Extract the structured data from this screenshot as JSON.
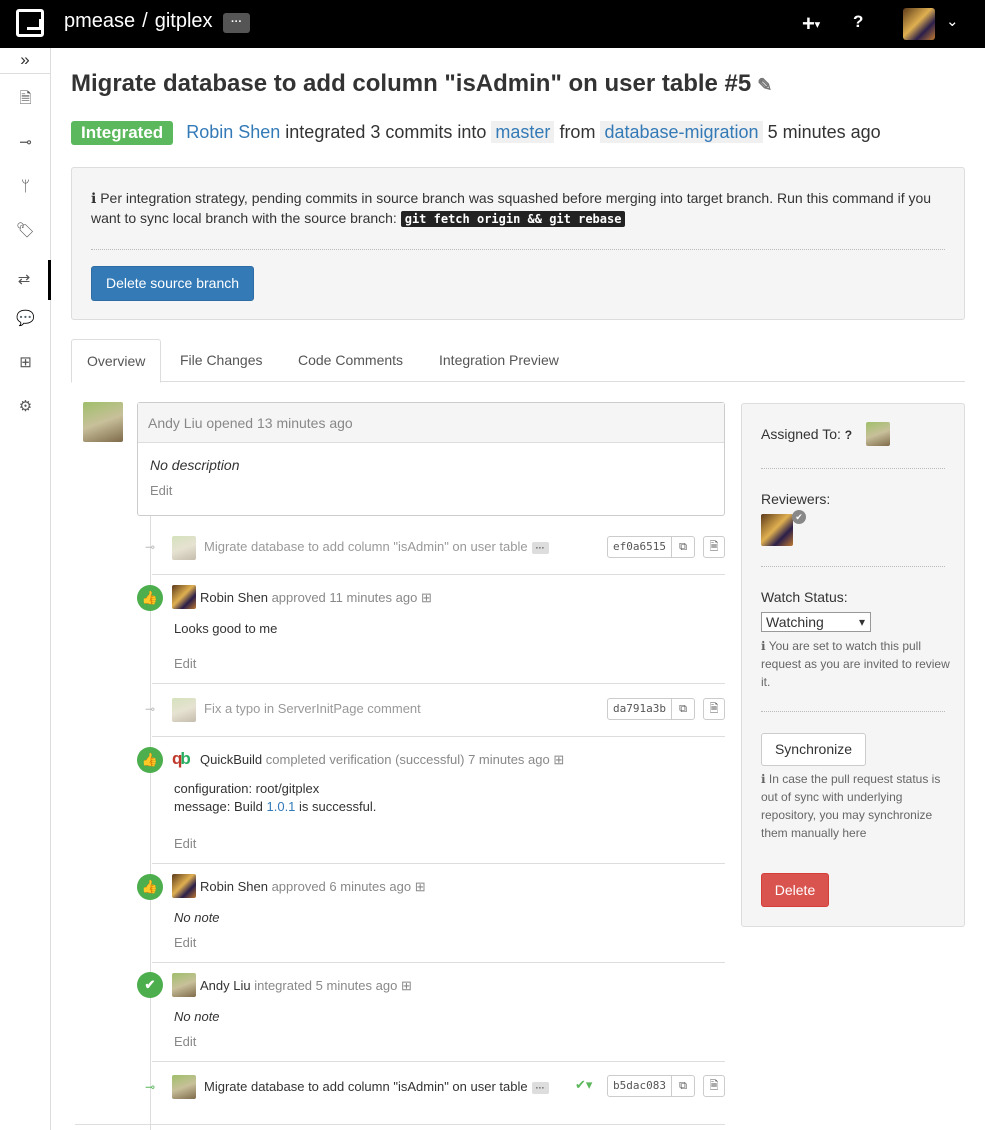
{
  "topbar": {
    "project_owner": "pmease",
    "separator": "/",
    "project_name": "gitplex",
    "more": "···",
    "plus": "+",
    "plus_caret": "▾",
    "help": "?",
    "caret": "⌄"
  },
  "sidebar": {
    "collapse": "»",
    "items": [
      {
        "name": "files",
        "glyph": "🗎"
      },
      {
        "name": "commits",
        "glyph": "⊸"
      },
      {
        "name": "branches",
        "glyph": "ᛘ"
      },
      {
        "name": "tags",
        "glyph": "🏷"
      },
      {
        "name": "pull-requests",
        "glyph": "⇄"
      },
      {
        "name": "comments",
        "glyph": "💬"
      },
      {
        "name": "compare",
        "glyph": "⊞"
      },
      {
        "name": "settings",
        "glyph": "⚙"
      }
    ]
  },
  "pr": {
    "title": "Migrate database to add column \"isAdmin\" on user table #5",
    "pencil": "✎",
    "status": "Integrated",
    "actor": "Robin Shen",
    "action": "integrated 3 commits into",
    "target_branch": "master",
    "from": "from",
    "source_branch": "database-migration",
    "time": "5 minutes ago"
  },
  "info": {
    "icon": "ℹ",
    "text": "Per integration strategy, pending commits in source branch was squashed before merging into target branch. Run this command if you want to sync local branch with the source branch:",
    "command": "git fetch origin && git rebase",
    "button": "Delete source branch"
  },
  "tabs": [
    "Overview",
    "File Changes",
    "Code Comments",
    "Integration Preview"
  ],
  "opener": {
    "head": "Andy Liu opened 13 minutes ago",
    "body": "No description",
    "edit": "Edit"
  },
  "events": {
    "c1": {
      "message": "Migrate database to add column \"isAdmin\" on user table",
      "hash": "ef0a6515"
    },
    "a1": {
      "user": "Robin Shen",
      "action": "approved 11 minutes ago",
      "body": "Looks good to me",
      "edit": "Edit"
    },
    "c2": {
      "message": "Fix a typo in ServerInitPage comment",
      "hash": "da791a3b"
    },
    "v1": {
      "user": "QuickBuild",
      "action": "completed verification (successful) 7 minutes ago",
      "line1": "configuration: root/gitplex",
      "line2_prefix": "message: Build ",
      "line2_link": "1.0.1",
      "line2_suffix": " is successful.",
      "edit": "Edit"
    },
    "a2": {
      "user": "Robin Shen",
      "action": "approved 6 minutes ago",
      "body": "No note",
      "edit": "Edit"
    },
    "i1": {
      "user": "Andy Liu",
      "action": "integrated 5 minutes ago",
      "body": "No note",
      "edit": "Edit"
    },
    "c3": {
      "message": "Migrate database to add column \"isAdmin\" on user table",
      "hash": "b5dac083",
      "check": "✔▾"
    }
  },
  "panel": {
    "assigned_to": "Assigned To:",
    "reviewers": "Reviewers:",
    "watch_status": "Watch Status:",
    "watch_value": "Watching",
    "watch_note": "You are set to watch this pull request as you are invited to review it.",
    "sync_button": "Synchronize",
    "sync_note": "In case the pull request status is out of sync with underlying repository, you may synchronize them manually here",
    "delete_button": "Delete"
  },
  "colors": {
    "integrated": "#5cb85c",
    "primary": "#337ab7",
    "danger": "#d9534f"
  }
}
